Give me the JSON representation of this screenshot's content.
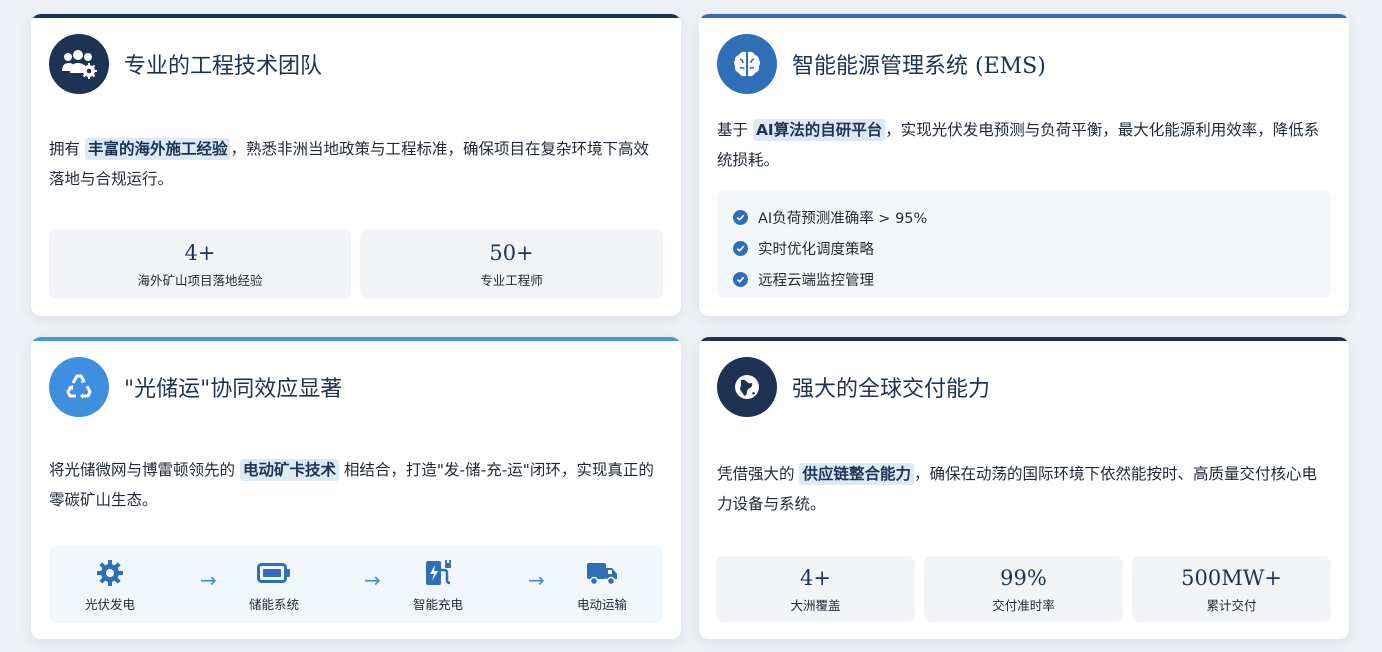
{
  "colors": {
    "navy": "#1e3354",
    "blue": "#2f6fb8",
    "light_blue": "#3f8fe0",
    "highlight_bg": "#dde9f7"
  },
  "team": {
    "icon": "team-gear-icon",
    "title": "专业的工程技术团队",
    "desc_pre": "拥有 ",
    "desc_hl": "丰富的海外施工经验",
    "desc_post": "，熟悉非洲当地政策与工程标准，确保项目在复杂环境下高效落地与合规运行。",
    "stats": [
      {
        "num": "4+",
        "label": "海外矿山项目落地经验"
      },
      {
        "num": "50+",
        "label": "专业工程师"
      }
    ]
  },
  "ems": {
    "icon": "brain-icon",
    "title": "智能能源管理系统 (EMS)",
    "desc_pre": "基于 ",
    "desc_hl": "AI算法的自研平台",
    "desc_post": "，实现光伏发电预测与负荷平衡，最大化能源利用效率，降低系统损耗。",
    "features": [
      "AI负荷预测准确率 > 95%",
      "实时优化调度策略",
      "远程云端监控管理"
    ]
  },
  "synergy": {
    "icon": "recycle-icon",
    "title": "\"光储运\"协同效应显著",
    "desc_pre": "将光储微网与博雷顿领先的 ",
    "desc_hl": "电动矿卡技术",
    "desc_post": " 相结合，打造\"发-储-充-运\"闭环，实现真正的零碳矿山生态。",
    "flow": [
      {
        "icon": "solar-gear-icon",
        "label": "光伏发电"
      },
      {
        "icon": "battery-icon",
        "label": "储能系统"
      },
      {
        "icon": "charging-station-icon",
        "label": "智能充电"
      },
      {
        "icon": "truck-icon",
        "label": "电动运输"
      }
    ],
    "arrow": "→"
  },
  "delivery": {
    "icon": "globe-icon",
    "title": "强大的全球交付能力",
    "desc_pre": "凭借强大的 ",
    "desc_hl": "供应链整合能力",
    "desc_post": "，确保在动荡的国际环境下依然能按时、高质量交付核心电力设备与系统。",
    "stats": [
      {
        "num": "4+",
        "label": "大洲覆盖"
      },
      {
        "num": "99%",
        "label": "交付准时率"
      },
      {
        "num": "500MW+",
        "label": "累计交付"
      }
    ]
  }
}
